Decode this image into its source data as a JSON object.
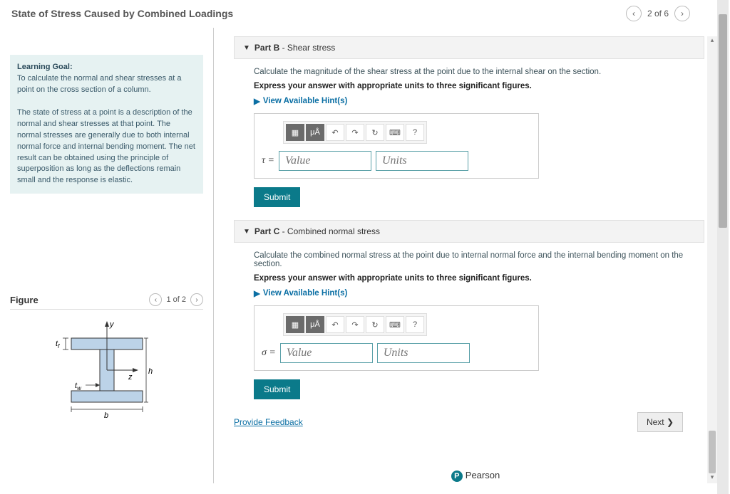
{
  "header": {
    "title": "State of Stress Caused by Combined Loadings",
    "page_indicator": "2 of 6"
  },
  "left": {
    "learning_goal_label": "Learning Goal:",
    "learning_goal_text1": "To calculate the normal and shear stresses at a point on the cross section of a column.",
    "learning_goal_text2": "The state of stress at a point is a description of the normal and shear stresses at that point. The normal stresses are generally due to both internal normal force and internal bending moment. The net result can be obtained using the principle of superposition as long as the deflections remain small and the response is elastic.",
    "figure_label": "Figure",
    "figure_page": "1 of 2",
    "diagram_labels": {
      "y": "y",
      "z": "z",
      "h": "h",
      "b": "b",
      "tf": "t",
      "tf_sub": "f",
      "tw": "t",
      "tw_sub": "w"
    }
  },
  "parts": [
    {
      "key": "B",
      "label": "Part B",
      "subtitle": "Shear stress",
      "prompt": "Calculate the magnitude of the shear stress at the point due to the internal shear on the section.",
      "express": "Express your answer with appropriate units to three significant figures.",
      "hints": "View Available Hint(s)",
      "symbol": "τ =",
      "value_ph": "Value",
      "units_ph": "Units",
      "submit": "Submit"
    },
    {
      "key": "C",
      "label": "Part C",
      "subtitle": "Combined normal stress",
      "prompt": "Calculate the combined normal stress at the point due to internal normal force and the internal bending moment on the section.",
      "express": "Express your answer with appropriate units to three significant figures.",
      "hints": "View Available Hint(s)",
      "symbol": "σ =",
      "value_ph": "Value",
      "units_ph": "Units",
      "submit": "Submit"
    }
  ],
  "toolbar_icons": [
    "▦",
    "μÅ",
    "↶",
    "↷",
    "↻",
    "⌨",
    "?"
  ],
  "footer": {
    "feedback": "Provide Feedback",
    "next": "Next ❯",
    "brand": "Pearson"
  }
}
